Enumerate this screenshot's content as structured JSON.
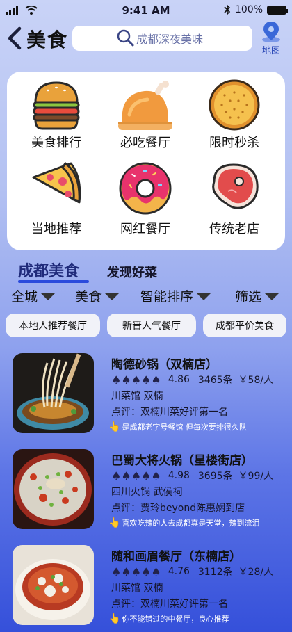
{
  "status": {
    "time": "9:41 AM",
    "battery": "100%",
    "battery_level": 1.0
  },
  "header": {
    "title": "美食",
    "search_placeholder": "成都深夜美味",
    "map_label": "地图"
  },
  "categories": [
    {
      "label": "美食排行",
      "icon": "burger-icon"
    },
    {
      "label": "必吃餐厅",
      "icon": "roast-chicken-icon"
    },
    {
      "label": "限时秒杀",
      "icon": "cracker-icon"
    },
    {
      "label": "当地推荐",
      "icon": "pizza-icon"
    },
    {
      "label": "网红餐厅",
      "icon": "donut-icon"
    },
    {
      "label": "传统老店",
      "icon": "steak-icon"
    }
  ],
  "section_tabs": {
    "active": "成都美食",
    "other": "发现好菜"
  },
  "filters": [
    "全城",
    "美食",
    "智能排序",
    "筛选"
  ],
  "quick_tags": [
    "本地人推荐餐厅",
    "新晋人气餐厅",
    "成都平价美食"
  ],
  "restaurants": [
    {
      "name": "陶德砂锅（双楠店）",
      "stars": "♠♠♠♠♠",
      "rating": "4.86",
      "reviews": "3465条",
      "price": "￥58/人",
      "tags": "川菜馆 双楠",
      "review": "点评：双楠川菜好评第一名",
      "tip": "是成都老字号餐馆 但每次要排很久队"
    },
    {
      "name": "巴蜀大将火锅（星楼街店）",
      "stars": "♠♠♠♠♠",
      "rating": "4.98",
      "reviews": "3695条",
      "price": "￥99/人",
      "tags": "四川火锅 武侯祠",
      "review": "点评：贾玲beyond陈惠娴到店",
      "tip": "喜欢吃辣的人去成都真是天堂，辣到流泪"
    },
    {
      "name": "随和画眉餐厅（东楠店）",
      "stars": "♠♠♠♠♠",
      "rating": "4.76",
      "reviews": "3112条",
      "price": "￥28/人",
      "tags": "川菜馆 双楠",
      "review": "点评：双楠川菜好评第一名",
      "tip": "你不能错过的中餐厅，良心推荐"
    }
  ]
}
